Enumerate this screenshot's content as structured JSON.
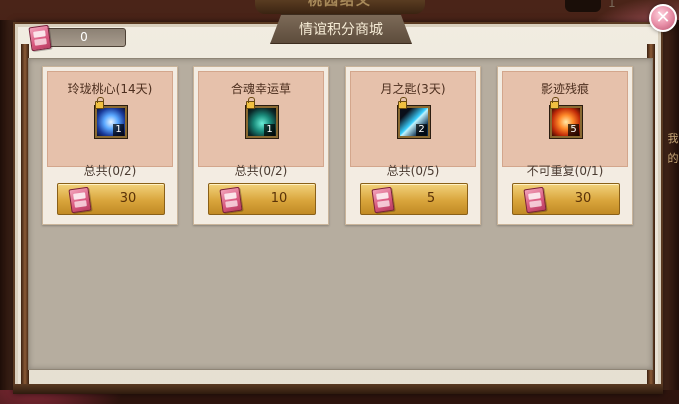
{
  "background": {
    "banner_text": "桃园结义",
    "corner_number": "1",
    "side_labels": [
      "我",
      "的"
    ]
  },
  "window": {
    "title": "情谊积分商城",
    "points_value": "0",
    "close_symbol": "✕"
  },
  "items": [
    {
      "name": "玲珑桃心(14天)",
      "count": "1",
      "limit": "总共(0/2)",
      "price": "30",
      "art": "heart"
    },
    {
      "name": "合魂幸运草",
      "count": "1",
      "limit": "总共(0/2)",
      "price": "10",
      "art": "herb"
    },
    {
      "name": "月之匙(3天)",
      "count": "2",
      "limit": "总共(0/5)",
      "price": "5",
      "art": "key"
    },
    {
      "name": "影迹残痕",
      "count": "5",
      "limit": "不可重复(0/1)",
      "price": "30",
      "art": "trace"
    }
  ],
  "icons": {
    "currency": "friendship-ticket-icon",
    "lock": "lock-icon",
    "close": "close-icon"
  },
  "colors": {
    "panel_bg": "#f1ece1",
    "card_head": "#e6c1ab",
    "button_gold": "#d9a53c",
    "title_tab": "#6d5a48",
    "close_pink": "#e890a8"
  }
}
